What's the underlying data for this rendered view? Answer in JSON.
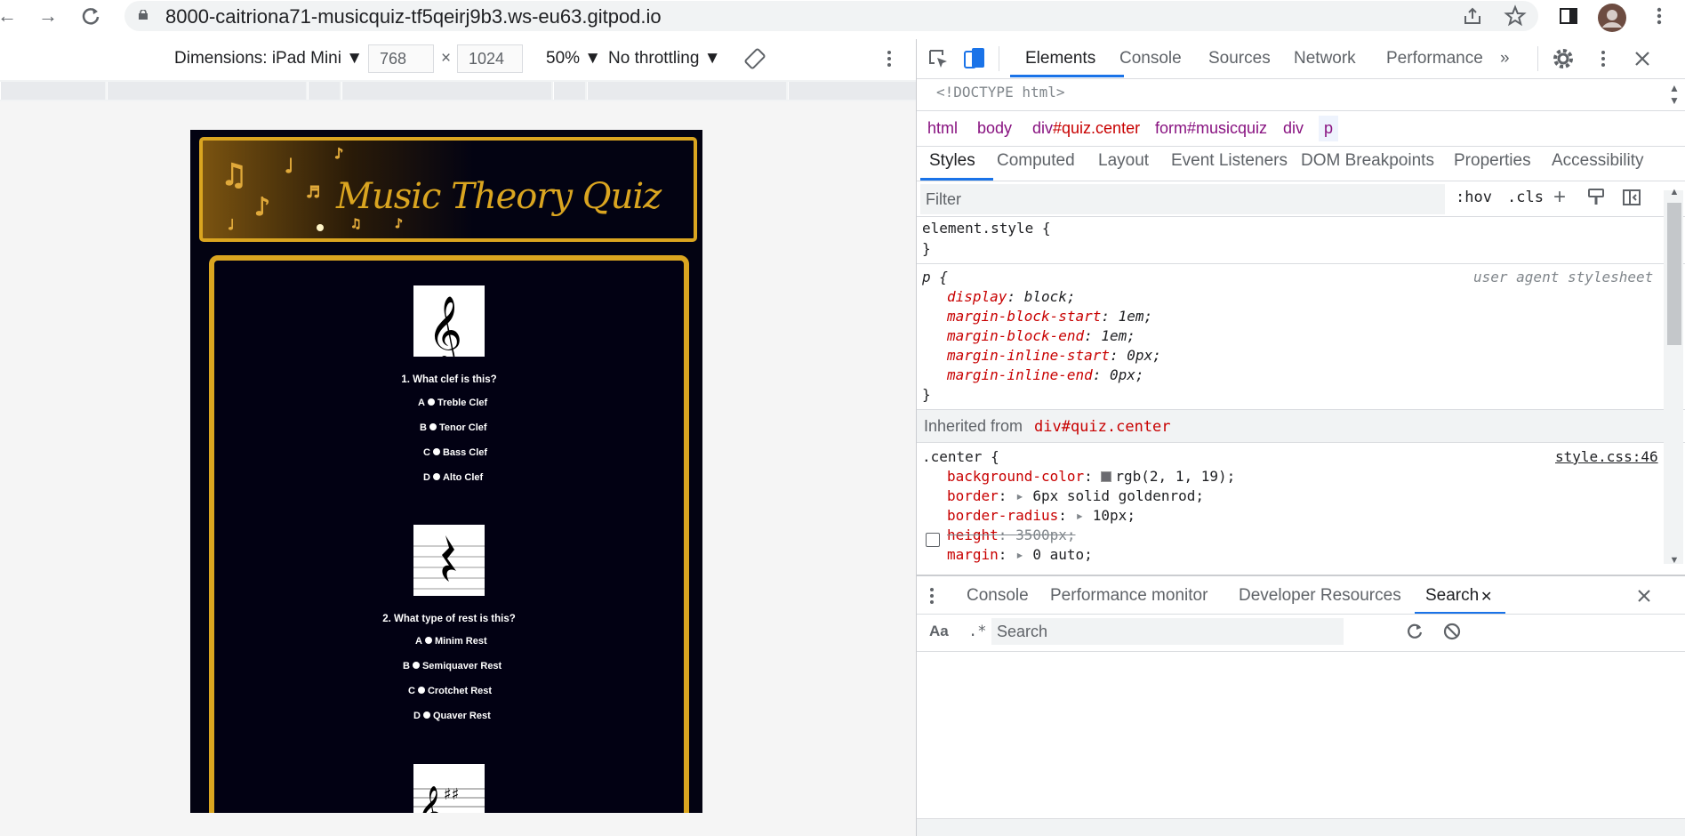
{
  "browser": {
    "url": "8000-caitriona71-musicquiz-tf5qeirj9b3.ws-eu63.gitpod.io"
  },
  "device_toolbar": {
    "dimensions_label": "Dimensions: iPad Mini",
    "width": "768",
    "separator": "×",
    "height": "1024",
    "zoom": "50%",
    "throttling": "No throttling"
  },
  "quiz_page": {
    "title": "Music Theory Quiz",
    "questions": [
      {
        "text": "1. What clef is this?",
        "image_icon": "treble-clef-icon",
        "options": [
          {
            "letter": "A",
            "label": "Treble Clef"
          },
          {
            "letter": "B",
            "label": "Tenor Clef"
          },
          {
            "letter": "C",
            "label": "Bass Clef"
          },
          {
            "letter": "D",
            "label": "Alto Clef"
          }
        ]
      },
      {
        "text": "2. What type of rest is this?",
        "image_icon": "crotchet-rest-icon",
        "options": [
          {
            "letter": "A",
            "label": "Minim Rest"
          },
          {
            "letter": "B",
            "label": "Semiquaver Rest"
          },
          {
            "letter": "C",
            "label": "Crotchet Rest"
          },
          {
            "letter": "D",
            "label": "Quaver Rest"
          }
        ]
      }
    ]
  },
  "devtools": {
    "tabs": [
      "Elements",
      "Console",
      "Sources",
      "Network",
      "Performance"
    ],
    "more_tabs": "»",
    "dom_preview": "<!DOCTYPE html>",
    "breadcrumbs": [
      {
        "tag": "html",
        "extra": ""
      },
      {
        "tag": "body",
        "extra": ""
      },
      {
        "tag": "div",
        "extra": "#quiz.center"
      },
      {
        "tag": "form",
        "extra": "#musicquiz"
      },
      {
        "tag": "div",
        "extra": ""
      },
      {
        "tag": "p",
        "extra": ""
      }
    ],
    "style_tabs": [
      "Styles",
      "Computed",
      "Layout",
      "Event Listeners",
      "DOM Breakpoints",
      "Properties",
      "Accessibility"
    ],
    "filter_placeholder": "Filter",
    "hov": ":hov",
    "cls": ".cls",
    "element_style": "element.style {",
    "close_brace": "}",
    "p_rule": {
      "selector": "p {",
      "source": "user agent stylesheet",
      "declarations": [
        {
          "prop": "display",
          "value": "block;"
        },
        {
          "prop": "margin-block-start",
          "value": "1em;"
        },
        {
          "prop": "margin-block-end",
          "value": "1em;"
        },
        {
          "prop": "margin-inline-start",
          "value": "0px;"
        },
        {
          "prop": "margin-inline-end",
          "value": "0px;"
        }
      ]
    },
    "inherited_label": "Inherited from",
    "inherited_from": "div#quiz.center",
    "center_rule": {
      "selector": ".center {",
      "source": "style.css:46",
      "declarations": [
        {
          "prop": "background-color",
          "value": "rgb(2, 1, 19);",
          "swatch": "#020113"
        },
        {
          "prop": "border",
          "value": "6px solid goldenrod;",
          "swatch": "#daa520"
        },
        {
          "prop": "border-radius",
          "value": "10px;"
        },
        {
          "prop": "height",
          "value": "3500px;"
        },
        {
          "prop": "margin",
          "value": "0 auto;"
        }
      ]
    },
    "drawer_tabs": [
      "Console",
      "Performance monitor",
      "Developer Resources",
      "Search"
    ],
    "search_case": "Aa",
    "search_regex": ".*",
    "search_placeholder": "Search"
  },
  "colors": {
    "accent_blue": "#1a73e8",
    "quiz_gold": "#daa520",
    "quiz_bg": "#020113"
  }
}
